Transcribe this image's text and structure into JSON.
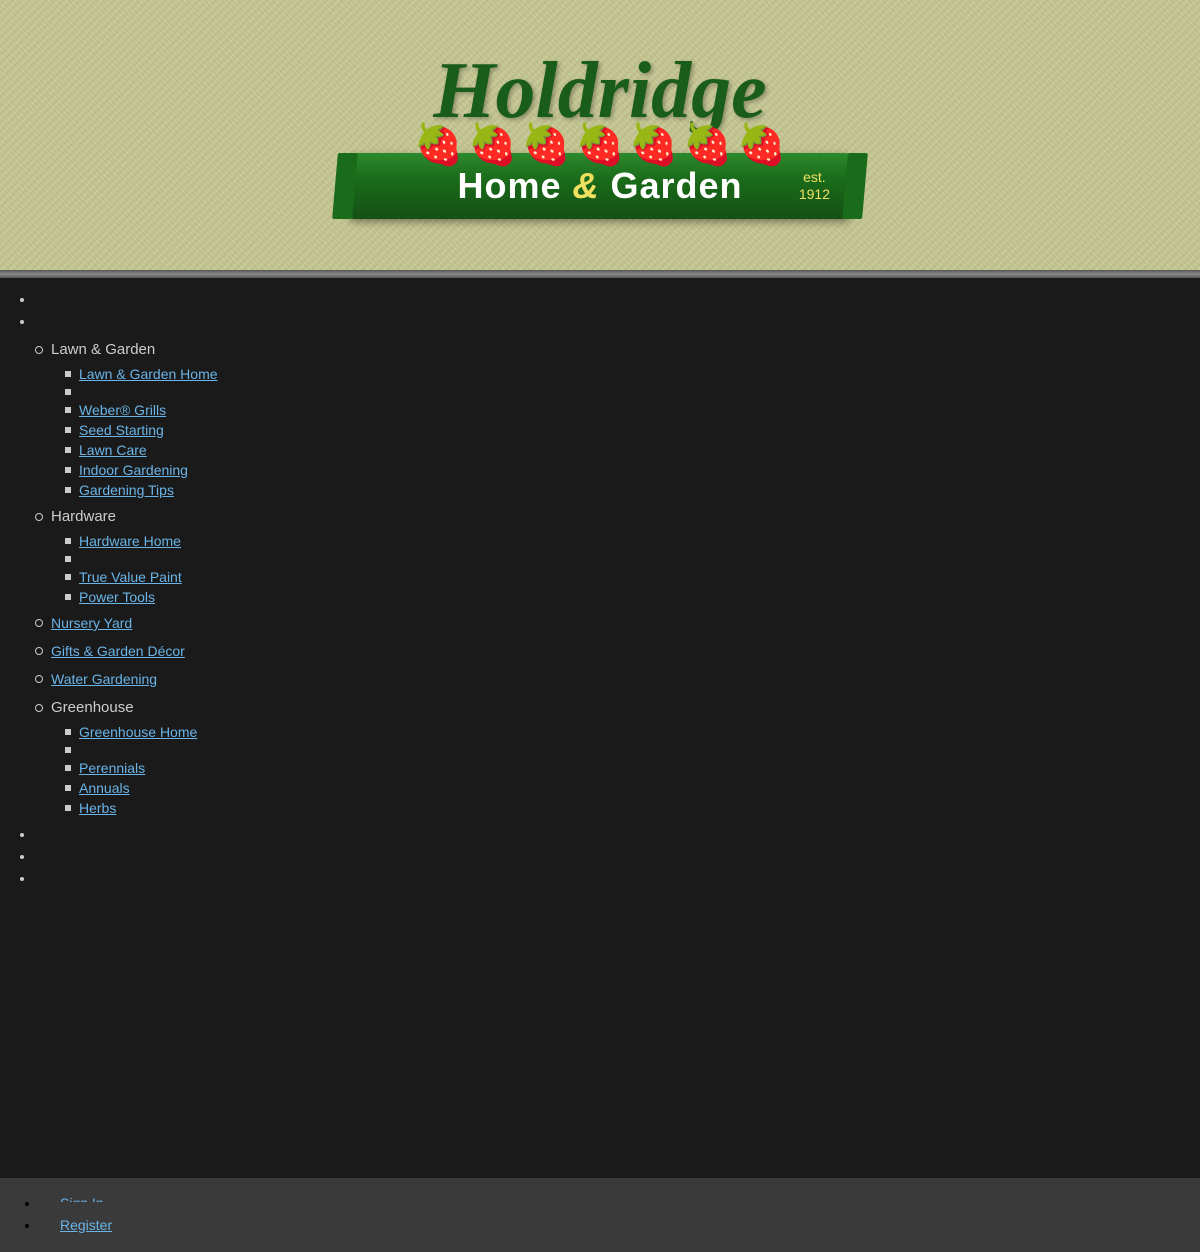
{
  "header": {
    "title": "Holdridge",
    "subtitle": "Home & Garden",
    "est": "est.\n1912",
    "ampersand": "&"
  },
  "nav": {
    "top_bullets": [
      "",
      ""
    ],
    "categories": [
      {
        "label": "Lawn & Garden",
        "subitems": [
          {
            "label": "Lawn & Garden Home",
            "link": true
          },
          {
            "label": "",
            "link": false
          },
          {
            "label": "Weber® Grills",
            "link": true
          },
          {
            "label": "Seed Starting",
            "link": true
          },
          {
            "label": "Lawn Care",
            "link": true
          },
          {
            "label": "Indoor Gardening",
            "link": true
          },
          {
            "label": "Gardening Tips",
            "link": true
          }
        ]
      },
      {
        "label": "Hardware",
        "subitems": [
          {
            "label": "Hardware Home",
            "link": true
          },
          {
            "label": "",
            "link": false
          },
          {
            "label": "True Value Paint",
            "link": true
          },
          {
            "label": "Power Tools",
            "link": true
          }
        ]
      },
      {
        "label": "Nursery Yard",
        "subitems": []
      },
      {
        "label": "Gifts & Garden Décor",
        "subitems": []
      },
      {
        "label": "Water Gardening",
        "subitems": []
      },
      {
        "label": "Greenhouse",
        "subitems": [
          {
            "label": "Greenhouse Home",
            "link": true
          },
          {
            "label": "",
            "link": false
          },
          {
            "label": "Perennials",
            "link": true
          },
          {
            "label": "Annuals",
            "link": true
          },
          {
            "label": "Herbs",
            "link": true
          }
        ]
      }
    ],
    "bottom_bullets": [
      "",
      "",
      ""
    ],
    "footer_links": [
      {
        "label": "Sign In"
      },
      {
        "label": "Register"
      }
    ]
  }
}
